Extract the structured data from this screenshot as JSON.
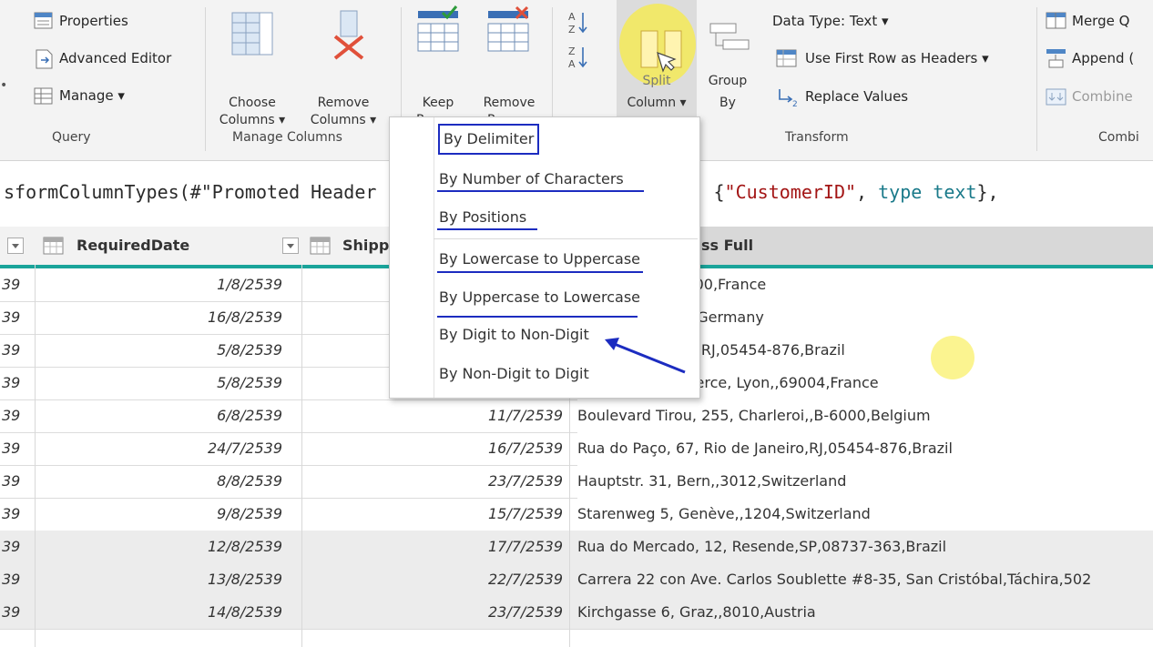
{
  "ribbon": {
    "query_group": {
      "properties": "Properties",
      "advanced_editor": "Advanced Editor",
      "manage": "Manage ▾",
      "group_label": "Query"
    },
    "manage_columns_group": {
      "choose_columns": [
        "Choose",
        "Columns ▾"
      ],
      "remove_columns": [
        "Remove",
        "Columns ▾"
      ],
      "group_label": "Manage Columns"
    },
    "reduce_rows_group": {
      "keep_rows": [
        "Keep",
        "Rows ▾"
      ],
      "remove_rows": [
        "Remove",
        "Rows ▾"
      ]
    },
    "split_column": [
      "Split",
      "Column ▾"
    ],
    "group_by": [
      "Group",
      "By"
    ],
    "transform_group": {
      "data_type": "Data Type: Text ▾",
      "use_first_row": "Use First Row as Headers ▾",
      "replace_values": "Replace Values",
      "group_label": "Transform"
    },
    "combine_group": {
      "merge": "Merge Q",
      "append": "Append (",
      "combine": "Combine",
      "group_label": "Combi"
    }
  },
  "formula": {
    "part1": "sformColumnTypes(#\"Promoted Header",
    "part2": ", {",
    "part3": "\"CustomerID\"",
    "part4": ", ",
    "part5": "type text",
    "part6": "},"
  },
  "grid": {
    "headers": {
      "col1": "RequiredDate",
      "col2": "Shipp",
      "col3": "ss Full"
    },
    "rows": [
      {
        "c0": "39",
        "c1": "1/8/2539",
        "c2": "",
        "c3": "aye, Reims,,51100,France"
      },
      {
        "c0": "39",
        "c1": "16/8/2539",
        "c2": "",
        "c3": "Münster,,44087,Germany"
      },
      {
        "c0": "39",
        "c1": "5/8/2539",
        "c2": "",
        "c3": "7, Rio de Janeiro,RJ,05454-876,Brazil"
      },
      {
        "c0": "39",
        "c1": "5/8/2539",
        "c2": "",
        "c3": "2, rue du Commerce, Lyon,,69004,France"
      },
      {
        "c0": "39",
        "c1": "6/8/2539",
        "c2": "11/7/2539",
        "c3": "Boulevard Tirou, 255, Charleroi,,B-6000,Belgium"
      },
      {
        "c0": "39",
        "c1": "24/7/2539",
        "c2": "16/7/2539",
        "c3": "Rua do Paço, 67, Rio de Janeiro,RJ,05454-876,Brazil"
      },
      {
        "c0": "39",
        "c1": "8/8/2539",
        "c2": "23/7/2539",
        "c3": "Hauptstr. 31, Bern,,3012,Switzerland"
      },
      {
        "c0": "39",
        "c1": "9/8/2539",
        "c2": "15/7/2539",
        "c3": "Starenweg 5, Genève,,1204,Switzerland"
      },
      {
        "c0": "39",
        "c1": "12/8/2539",
        "c2": "17/7/2539",
        "c3": "Rua do Mercado, 12, Resende,SP,08737-363,Brazil"
      },
      {
        "c0": "39",
        "c1": "13/8/2539",
        "c2": "22/7/2539",
        "c3": "Carrera 22 con Ave. Carlos Soublette #8-35, San Cristóbal,Táchira,502"
      },
      {
        "c0": "39",
        "c1": "14/8/2539",
        "c2": "23/7/2539",
        "c3": "Kirchgasse 6, Graz,,8010,Austria"
      }
    ]
  },
  "split_menu": {
    "items": [
      "By Delimiter",
      "By Number of Characters",
      "By Positions",
      "By Lowercase to Uppercase",
      "By Uppercase to Lowercase",
      "By Digit to Non-Digit",
      "By Non-Digit to Digit"
    ]
  },
  "colors": {
    "accent_teal": "#1aa49a",
    "annotation_blue": "#1c2cc0",
    "highlight_yellow": "#f8ec46"
  }
}
